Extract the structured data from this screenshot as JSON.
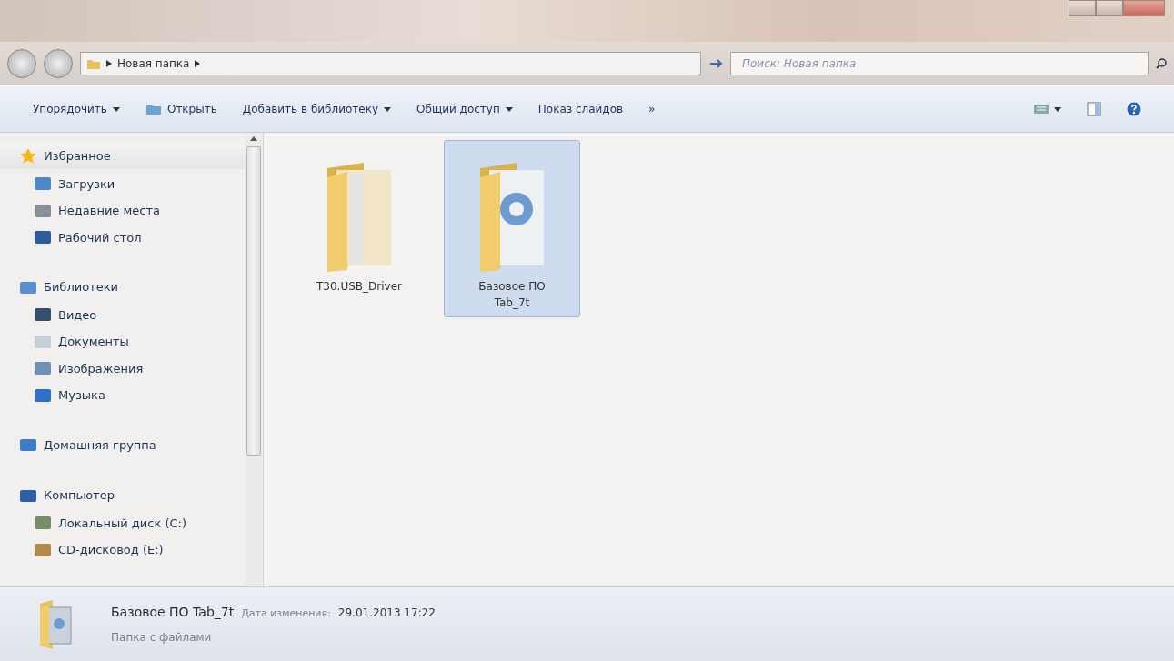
{
  "address": {
    "path": [
      "Новая папка"
    ]
  },
  "search": {
    "placeholder": "Поиск: Новая папка"
  },
  "toolbar": [
    {
      "label": "Упорядочить",
      "kind": "menu"
    },
    {
      "label": "Открыть",
      "kind": "icon"
    },
    {
      "label": "Добавить в библиотеку",
      "kind": "menu"
    },
    {
      "label": "Общий доступ",
      "kind": "menu"
    },
    {
      "label": "Показ слайдов",
      "kind": "plain"
    },
    {
      "label": "»",
      "kind": "plain"
    }
  ],
  "sidebar": {
    "groups": [
      {
        "label": "Избранное",
        "highlighted": true,
        "children": [
          {
            "label": "Загрузки"
          },
          {
            "label": "Недавние места"
          },
          {
            "label": "Рабочий стол"
          }
        ]
      },
      {
        "label": "Библиотеки",
        "highlighted": false,
        "children": [
          {
            "label": "Видео"
          },
          {
            "label": "Документы"
          },
          {
            "label": "Изображения"
          },
          {
            "label": "Музыка"
          }
        ]
      },
      {
        "label": "Домашняя группа",
        "highlighted": false
      },
      {
        "label": "Компьютер",
        "highlighted": false,
        "children": [
          {
            "label": "Локальный диск (C:)"
          },
          {
            "label": "CD-дисковод (E:)"
          }
        ]
      }
    ]
  },
  "files": [
    {
      "name": "T30.USB_Driver",
      "selected": false
    },
    {
      "name": "Базовое ПО Tab_7t",
      "selected": true
    }
  ],
  "details": {
    "name": "Базовое ПО Tab_7t",
    "date_label": "Дата изменения:",
    "date": "29.01.2013 17:22",
    "type": "Папка с файлами"
  }
}
